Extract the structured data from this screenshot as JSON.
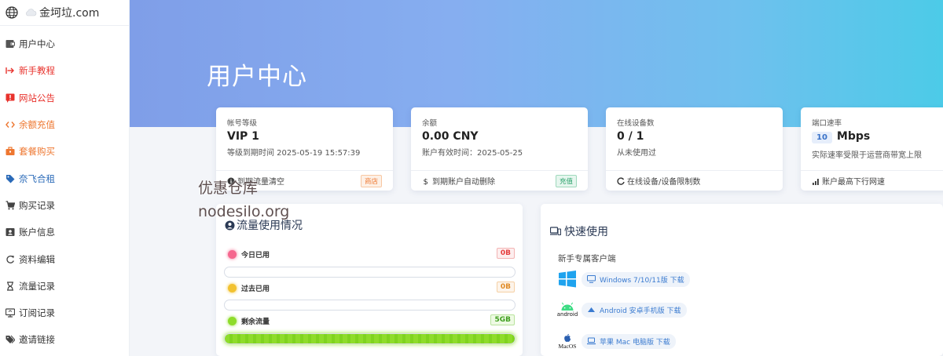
{
  "brand": {
    "name": "金坷垃.com"
  },
  "sidebar": {
    "items": [
      {
        "label": "用户中心",
        "icon": "wallet-icon"
      },
      {
        "label": "新手教程",
        "icon": "sign-in-icon"
      },
      {
        "label": "网站公告",
        "icon": "exclamation-icon"
      },
      {
        "label": "余额充值",
        "icon": "code-icon"
      },
      {
        "label": "套餐购买",
        "icon": "briefcase-icon"
      },
      {
        "label": "奈飞合租",
        "icon": "tag-icon"
      },
      {
        "label": "购买记录",
        "icon": "cart-icon"
      },
      {
        "label": "账户信息",
        "icon": "id-card-icon"
      },
      {
        "label": "资料编辑",
        "icon": "refresh-icon"
      },
      {
        "label": "流量记录",
        "icon": "hourglass-icon"
      },
      {
        "label": "订阅记录",
        "icon": "monitor-icon"
      },
      {
        "label": "邀请链接",
        "icon": "tags-icon"
      }
    ]
  },
  "hero": {
    "title": "用户中心"
  },
  "cards": {
    "level": {
      "label": "帐号等级",
      "value": "VIP 1",
      "sub": "等级到期时间 2025-05-19 15:57:39",
      "footer": "到期流量清空",
      "badge": "商店"
    },
    "balance": {
      "label": "余额",
      "value": "0.00 CNY",
      "sub": "账户有效时间：2025-05-25",
      "footer": "到期账户自动删除",
      "badge": "充值"
    },
    "devices": {
      "label": "在线设备数",
      "value": "0 / 1",
      "sub": "从未使用过",
      "footer": "在线设备/设备限制数"
    },
    "speed": {
      "label": "端口速率",
      "value_num": "10",
      "value_unit": "Mbps",
      "sub": "实际速率受限于运营商带宽上限",
      "footer": "账户最高下行网速"
    }
  },
  "watermark": {
    "line1": "优惠仓库",
    "line2": "nodesilo.org"
  },
  "traffic": {
    "title": "流量使用情况",
    "rows": [
      {
        "label": "今日已用",
        "value": "0B",
        "color": "#f5678e",
        "fill": 0
      },
      {
        "label": "过去已用",
        "value": "0B",
        "color": "#f2c230",
        "fill": 0
      },
      {
        "label": "剩余流量",
        "value": "5GB",
        "color": "#8edc2a",
        "fill": 1
      }
    ]
  },
  "quick": {
    "title": "快速使用",
    "subtitle": "新手专属客户端",
    "downloads": [
      {
        "os": "windows-icon",
        "label": "Windows 7/10/11版 下载"
      },
      {
        "os": "android-icon",
        "label": "Android 安卓手机版 下载",
        "os_text": "android"
      },
      {
        "os": "macos-icon",
        "label": "苹果 Mac 电脑版 下载",
        "os_text": "MacOS"
      }
    ]
  }
}
